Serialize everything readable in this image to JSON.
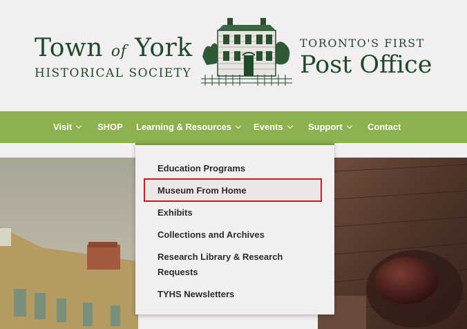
{
  "header": {
    "logo_left_line1_a": "Town ",
    "logo_left_line1_of": "of",
    "logo_left_line1_b": " York",
    "logo_left_line2": "HISTORICAL SOCIETY",
    "logo_right_line1": "TORONTO'S FIRST",
    "logo_right_line2": "Post Office"
  },
  "nav": {
    "items": [
      {
        "label": "Visit",
        "has_submenu": true
      },
      {
        "label": "SHOP",
        "has_submenu": false
      },
      {
        "label": "Learning & Resources",
        "has_submenu": true
      },
      {
        "label": "Events",
        "has_submenu": true
      },
      {
        "label": "Support",
        "has_submenu": true
      },
      {
        "label": "Contact",
        "has_submenu": false
      }
    ]
  },
  "dropdown": {
    "items": [
      {
        "label": "Education Programs"
      },
      {
        "label": "Museum From Home",
        "highlighted": true
      },
      {
        "label": "Exhibits"
      },
      {
        "label": "Collections and Archives"
      },
      {
        "label": "Research Library & Research Requests"
      },
      {
        "label": "TYHS Newsletters"
      }
    ]
  },
  "colors": {
    "nav_green": "#8db14e",
    "logo_green": "#1f4a2a",
    "highlight_red": "#d01818",
    "background": "#f2eff0"
  }
}
